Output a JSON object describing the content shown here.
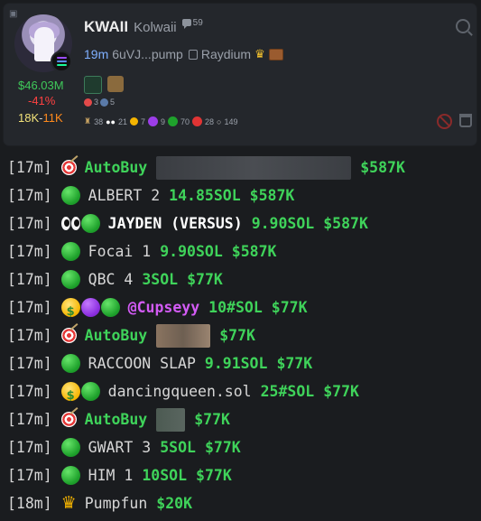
{
  "token": {
    "ticker": "KWAII",
    "name": "Kolwaii",
    "chat_count": "59",
    "age": "19m",
    "address": "6uVJ...pump",
    "dex": "Raydium",
    "market_cap": "$46.03M",
    "change": "-41%",
    "holders_a": "18K",
    "holders_sep": "-",
    "holders_b": "11K",
    "mini_stats": [
      "3",
      "5"
    ],
    "row_stats": [
      "38",
      "21",
      "7",
      "9",
      "70",
      "28",
      "149"
    ]
  },
  "feed": [
    {
      "time": "[17m]",
      "icon": "target",
      "name": "AutoBuy",
      "name_style": "green",
      "blur": 216,
      "amount": "",
      "mcap": "$587K"
    },
    {
      "time": "[17m]",
      "icon": "green",
      "name": "ALBERT 2",
      "name_style": "plain",
      "amount": "14.85SOL",
      "mcap": "$587K"
    },
    {
      "time": "[17m]",
      "icon": "eyes-green",
      "name": "JAYDEN (VERSUS)",
      "name_style": "bold",
      "amount": "9.90SOL",
      "mcap": "$587K"
    },
    {
      "time": "[17m]",
      "icon": "green",
      "name": "Focai 1",
      "name_style": "plain",
      "amount": "9.90SOL",
      "mcap": "$587K"
    },
    {
      "time": "[17m]",
      "icon": "green",
      "name": "QBC 4",
      "name_style": "plain",
      "amount": "3SOL",
      "mcap": "$77K"
    },
    {
      "time": "[17m]",
      "icon": "money-purple-green",
      "name": "@Cupseyy",
      "name_style": "purple",
      "amount": "10#SOL",
      "mcap": "$77K"
    },
    {
      "time": "[17m]",
      "icon": "target",
      "name": "AutoBuy",
      "name_style": "green",
      "blur": 60,
      "amount": "",
      "mcap": "$77K"
    },
    {
      "time": "[17m]",
      "icon": "green",
      "name": "RACCOON SLAP",
      "name_style": "plain",
      "amount": "9.91SOL",
      "mcap": "$77K"
    },
    {
      "time": "[17m]",
      "icon": "money-green",
      "name": "dancingqueen.sol",
      "name_style": "plain",
      "amount": "25#SOL",
      "mcap": "$77K"
    },
    {
      "time": "[17m]",
      "icon": "target",
      "name": "AutoBuy",
      "name_style": "green",
      "blur": 32,
      "amount": "",
      "mcap": "$77K"
    },
    {
      "time": "[17m]",
      "icon": "green",
      "name": "GWART 3",
      "name_style": "plain",
      "amount": "5SOL",
      "mcap": "$77K"
    },
    {
      "time": "[17m]",
      "icon": "green",
      "name": "HIM 1",
      "name_style": "plain",
      "amount": "10SOL",
      "mcap": "$77K"
    },
    {
      "time": "[18m]",
      "icon": "crown",
      "name": "Pumpfun",
      "name_style": "plain",
      "amount": "",
      "mcap": "$20K"
    }
  ],
  "colors": {
    "green": "#3fd35a",
    "red": "#ff4141",
    "purple": "#d35bf5",
    "link": "#7fb0ff"
  }
}
